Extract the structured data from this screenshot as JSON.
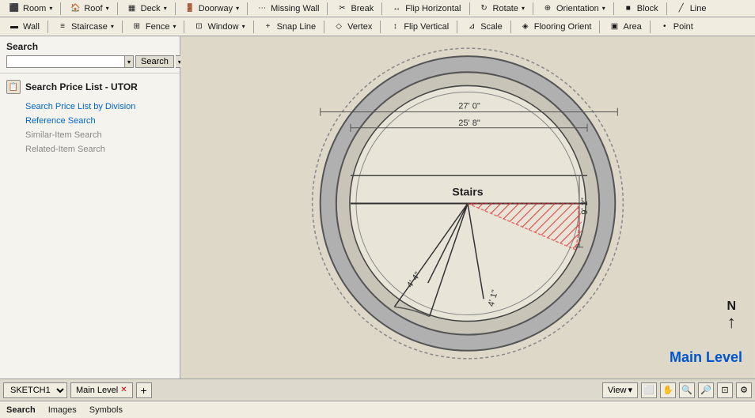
{
  "toolbar1": {
    "items": [
      {
        "id": "room",
        "label": "Room",
        "icon": "⬛",
        "has_arrow": true
      },
      {
        "id": "roof",
        "label": "Roof",
        "icon": "🏠",
        "has_arrow": true
      },
      {
        "id": "deck",
        "label": "Deck",
        "icon": "▦",
        "has_arrow": true
      },
      {
        "id": "doorway",
        "label": "Doorway",
        "icon": "🚪",
        "has_arrow": true
      },
      {
        "id": "missing-wall",
        "label": "Missing Wall",
        "icon": "…",
        "has_arrow": false
      },
      {
        "id": "break",
        "label": "Break",
        "icon": "✂",
        "has_arrow": false
      },
      {
        "id": "flip-horizontal",
        "label": "Flip Horizontal",
        "icon": "↔",
        "has_arrow": false
      },
      {
        "id": "rotate",
        "label": "Rotate",
        "icon": "↻",
        "has_arrow": true
      },
      {
        "id": "orientation",
        "label": "Orientation",
        "icon": "⊕",
        "has_arrow": true
      },
      {
        "id": "block",
        "label": "Block",
        "icon": "■",
        "has_arrow": false
      },
      {
        "id": "line",
        "label": "Line",
        "icon": "╱",
        "has_arrow": false
      }
    ]
  },
  "toolbar2": {
    "items": [
      {
        "id": "wall",
        "label": "Wall",
        "icon": "▬",
        "has_arrow": false
      },
      {
        "id": "staircase",
        "label": "Staircase",
        "icon": "≡",
        "has_arrow": true
      },
      {
        "id": "fence",
        "label": "Fence",
        "icon": "⊞",
        "has_arrow": true
      },
      {
        "id": "window",
        "label": "Window",
        "icon": "⊡",
        "has_arrow": true
      },
      {
        "id": "snap-line",
        "label": "Snap Line",
        "icon": "+",
        "has_arrow": false
      },
      {
        "id": "vertex",
        "label": "Vertex",
        "icon": "◇",
        "has_arrow": false
      },
      {
        "id": "flip-vertical",
        "label": "Flip Vertical",
        "icon": "↕",
        "has_arrow": false
      },
      {
        "id": "scale",
        "label": "Scale",
        "icon": "⊿",
        "has_arrow": false
      },
      {
        "id": "flooring-orient",
        "label": "Flooring Orient",
        "icon": "◈",
        "has_arrow": false
      },
      {
        "id": "area",
        "label": "Area",
        "icon": "▣",
        "has_arrow": false
      },
      {
        "id": "point",
        "label": "Point",
        "icon": "•",
        "has_arrow": false
      }
    ]
  },
  "search": {
    "label": "Search",
    "placeholder": "",
    "button_label": "Search"
  },
  "price_list": {
    "title": "Search Price List - UTOR",
    "links": [
      {
        "id": "by-division",
        "label": "Search Price List by Division",
        "muted": false
      },
      {
        "id": "reference",
        "label": "Reference Search",
        "muted": false
      },
      {
        "id": "similar",
        "label": "Similar-Item Search",
        "muted": true
      },
      {
        "id": "related",
        "label": "Related-Item Search",
        "muted": true
      }
    ]
  },
  "canvas": {
    "dimension1": "27' 0\"",
    "dimension2": "25' 8\"",
    "dimension3": "9' 2\"",
    "dimension4": "4' 4\"",
    "dimension5": "4' 1\"",
    "stairs_label": "Stairs"
  },
  "bottom_bar": {
    "sketch_name": "SKETCH1",
    "level_name": "Main Level",
    "add_label": "+",
    "view_label": "View",
    "main_level": "Main Level"
  },
  "status_tabs": [
    {
      "id": "search",
      "label": "Search",
      "active": true
    },
    {
      "id": "images",
      "label": "Images",
      "active": false
    },
    {
      "id": "symbols",
      "label": "Symbols",
      "active": false
    }
  ]
}
